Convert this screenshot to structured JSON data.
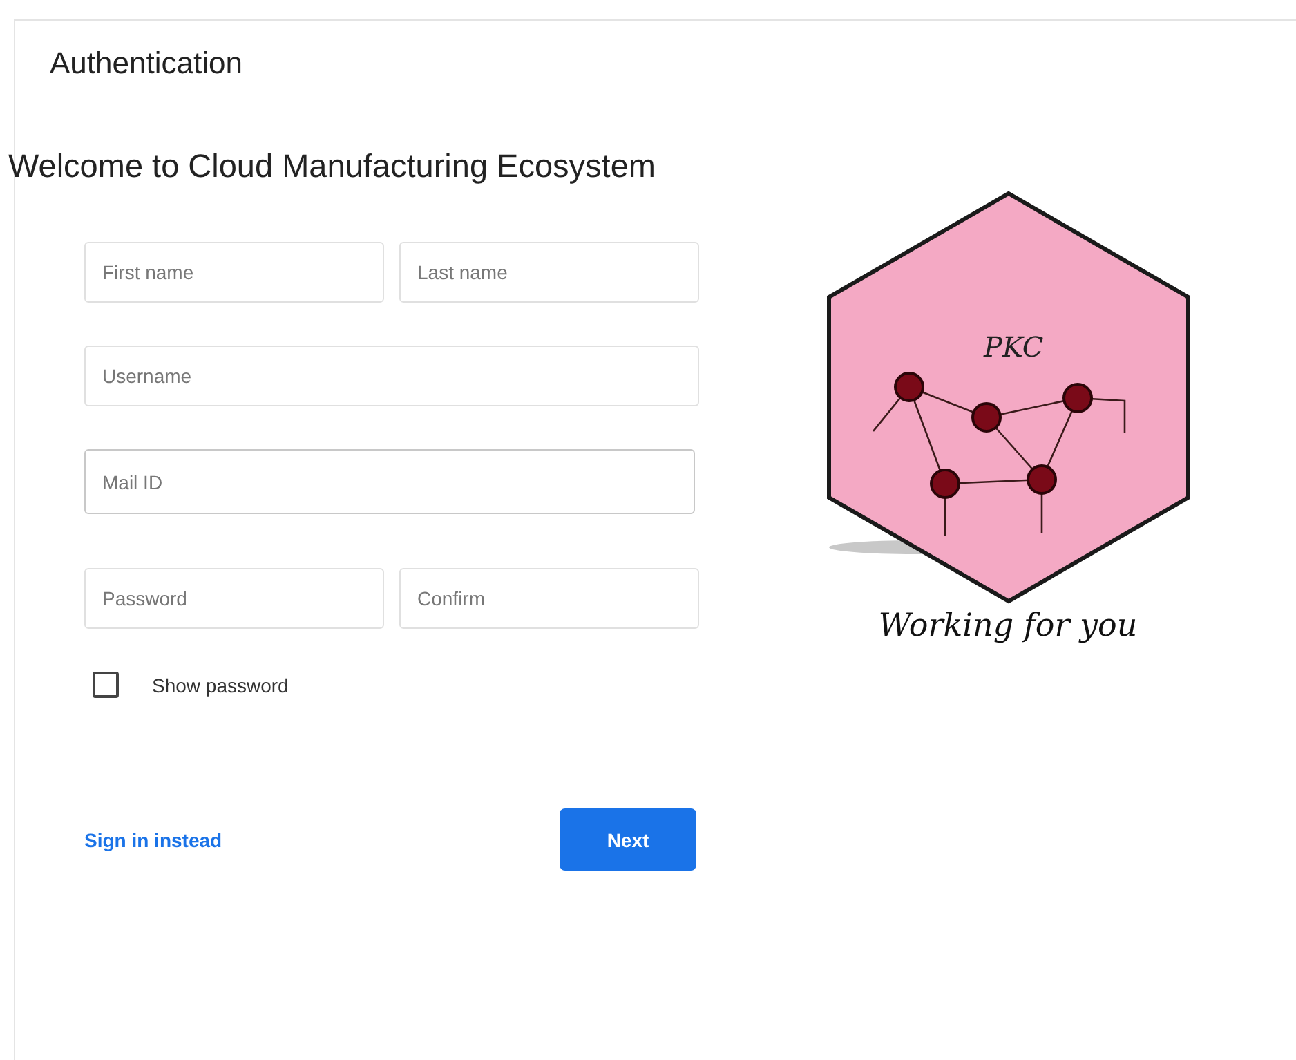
{
  "card": {
    "title": "Authentication"
  },
  "welcome": "Welcome to Cloud Manufacturing Ecosystem",
  "field_rows": [
    {
      "fields": [
        {
          "placeholder": "First name",
          "focused": false
        },
        {
          "placeholder": "Last name",
          "focused": false
        }
      ]
    },
    {
      "fields": [
        {
          "placeholder": "Username",
          "focused": false
        }
      ]
    },
    {
      "fields": [
        {
          "placeholder": "Mail ID",
          "focused": true
        }
      ]
    },
    {
      "fields": [
        {
          "placeholder": "Password",
          "focused": false
        },
        {
          "placeholder": "Confirm",
          "focused": false
        }
      ]
    }
  ],
  "show_password": {
    "label": "Show password",
    "checked": false
  },
  "sign_in_link": "Sign in instead",
  "next_button": "Next",
  "logo": {
    "title": "PKC",
    "tagline": "Working for you"
  }
}
